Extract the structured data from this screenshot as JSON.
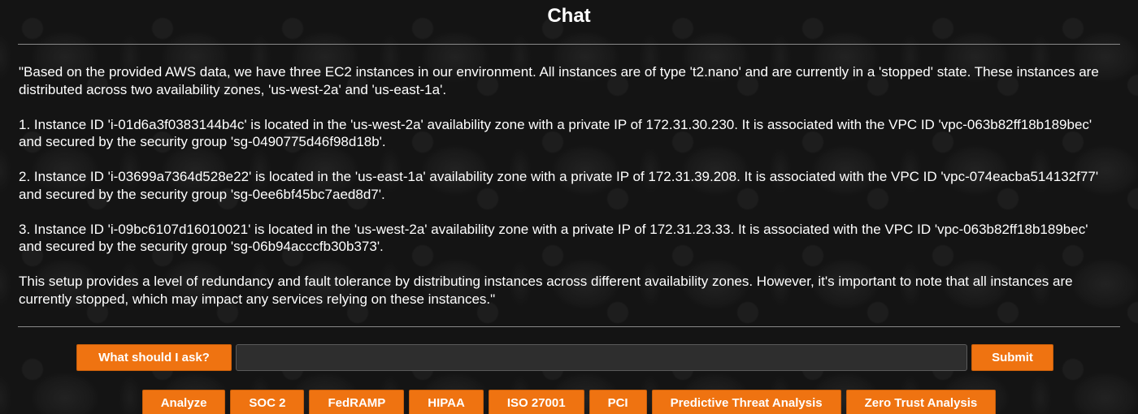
{
  "header": {
    "title": "Chat"
  },
  "message": {
    "paragraphs": [
      "\"Based on the provided AWS data, we have three EC2 instances in our environment. All instances are of type 't2.nano' and are currently in a 'stopped' state. These instances are distributed across two availability zones, 'us-west-2a' and 'us-east-1a'.",
      "1. Instance ID 'i-01d6a3f0383144b4c' is located in the 'us-west-2a' availability zone with a private IP of 172.31.30.230. It is associated with the VPC ID 'vpc-063b82ff18b189bec' and secured by the security group 'sg-0490775d46f98d18b'.",
      "2. Instance ID 'i-03699a7364d528e22' is located in the 'us-east-1a' availability zone with a private IP of 172.31.39.208. It is associated with the VPC ID 'vpc-074eacba514132f77' and secured by the security group 'sg-0ee6bf45bc7aed8d7'.",
      "3. Instance ID 'i-09bc6107d16010021' is located in the 'us-west-2a' availability zone with a private IP of 172.31.23.33. It is associated with the VPC ID 'vpc-063b82ff18b189bec' and secured by the security group 'sg-06b94acccfb30b373'.",
      "This setup provides a level of redundancy and fault tolerance by distributing instances across different availability zones. However, it's important to note that all instances are currently stopped, which may impact any services relying on these instances.\""
    ]
  },
  "input_bar": {
    "ask_label": "What should I ask?",
    "input_value": "",
    "submit_label": "Submit"
  },
  "quick_actions": [
    {
      "label": "Analyze"
    },
    {
      "label": "SOC 2"
    },
    {
      "label": "FedRAMP"
    },
    {
      "label": "HIPAA"
    },
    {
      "label": "ISO 27001"
    },
    {
      "label": "PCI"
    },
    {
      "label": "Predictive Threat Analysis"
    },
    {
      "label": "Zero Trust Analysis"
    }
  ],
  "colors": {
    "accent": "#ef7311",
    "background": "#141414",
    "text": "#ffffff"
  }
}
